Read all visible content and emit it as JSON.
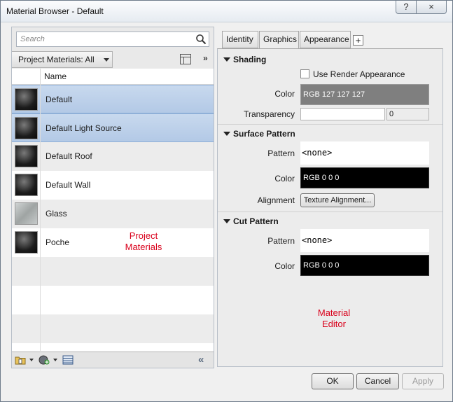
{
  "window": {
    "title": "Material Browser - Default",
    "help_label": "?",
    "close_label": "×"
  },
  "left": {
    "search_placeholder": "Search",
    "library_label": "Project Materials: All",
    "more_label": "»",
    "column_name": "Name",
    "items": [
      {
        "label": "Default",
        "icon": "sphere-dark-icon",
        "selected": true
      },
      {
        "label": "Default Light Source",
        "icon": "sphere-dark-icon",
        "selected": true
      },
      {
        "label": "Default Roof",
        "icon": "sphere-dark-icon",
        "selected": false
      },
      {
        "label": "Default Wall",
        "icon": "sphere-dark-icon",
        "selected": false
      },
      {
        "label": "Glass",
        "icon": "glass-swatch-icon",
        "selected": false
      },
      {
        "label": "Poche",
        "icon": "sphere-dark-icon",
        "selected": false
      }
    ],
    "collapse_label": "«",
    "annotation": "Project\nMaterials"
  },
  "right": {
    "tabs": [
      "Identity",
      "Graphics",
      "Appearance"
    ],
    "active_tab": "Graphics",
    "add_tab_label": "+",
    "shading": {
      "header": "Shading",
      "use_render_label": "Use Render Appearance",
      "use_render_checked": false,
      "color_label": "Color",
      "color_value": "RGB 127 127 127",
      "transparency_label": "Transparency",
      "transparency_value": "0"
    },
    "surface": {
      "header": "Surface Pattern",
      "pattern_label": "Pattern",
      "pattern_value": "<none>",
      "color_label": "Color",
      "color_value": "RGB 0 0 0",
      "alignment_label": "Alignment",
      "alignment_button": "Texture Alignment..."
    },
    "cut": {
      "header": "Cut Pattern",
      "pattern_label": "Pattern",
      "pattern_value": "<none>",
      "color_label": "Color",
      "color_value": "RGB 0 0 0"
    },
    "annotation": "Material\nEditor"
  },
  "buttons": {
    "ok": "OK",
    "cancel": "Cancel",
    "apply": "Apply"
  },
  "colors": {
    "shading_swatch": "#7f7f7f",
    "pattern_swatch": "#000000",
    "selection": "#b9cde8",
    "annotation": "#d9001b"
  }
}
